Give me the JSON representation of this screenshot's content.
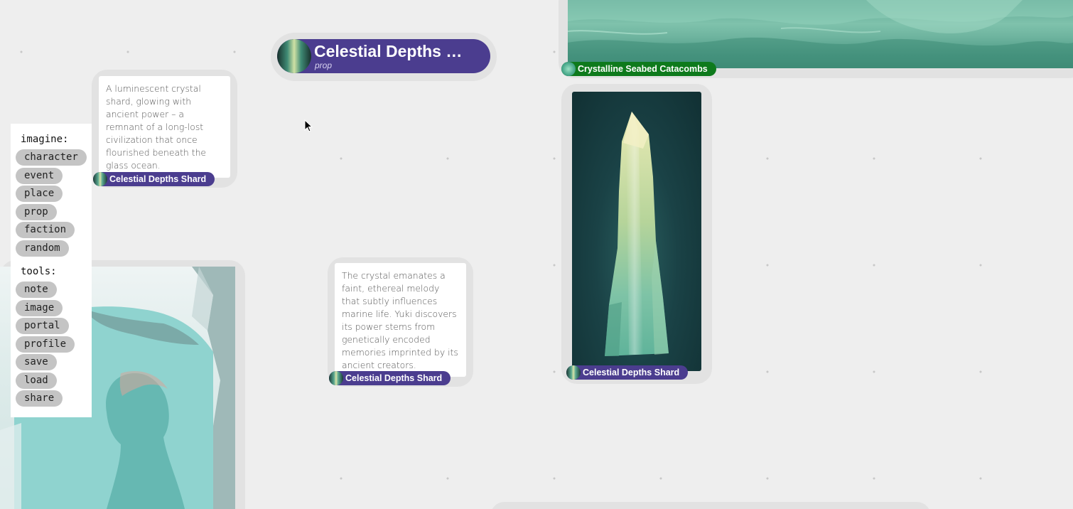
{
  "header_node": {
    "title": "Celestial Depths …",
    "subtitle": "prop"
  },
  "toolbar": {
    "imagine_heading": "imagine:",
    "imagine_items": [
      "character",
      "event",
      "place",
      "prop",
      "faction",
      "random"
    ],
    "tools_heading": "tools:",
    "tools_items": [
      "note",
      "image",
      "portal",
      "profile",
      "save",
      "load",
      "share"
    ]
  },
  "notes": [
    {
      "text": "A luminescent crystal shard, glowing with ancient power – a remnant of a long-lost civilization that once flourished beneath the glass ocean.",
      "label": "Celestial Depths Shard"
    },
    {
      "text": "The crystal emanates a faint, ethereal melody that subtly influences marine life. Yuki discovers its power stems from genetically encoded memories imprinted by its ancient creators.",
      "label": "Celestial Depths Shard"
    }
  ],
  "image_nodes": {
    "crystal_label": "Celestial Depths Shard",
    "seabed_label": "Crystalline Seabed Catacombs"
  },
  "colors": {
    "canvas": "#eeeeee",
    "prop_accent": "#4b3d8f",
    "place_accent": "#0e7a1c"
  },
  "icons": {
    "cursor": "arrow-cursor-icon"
  }
}
